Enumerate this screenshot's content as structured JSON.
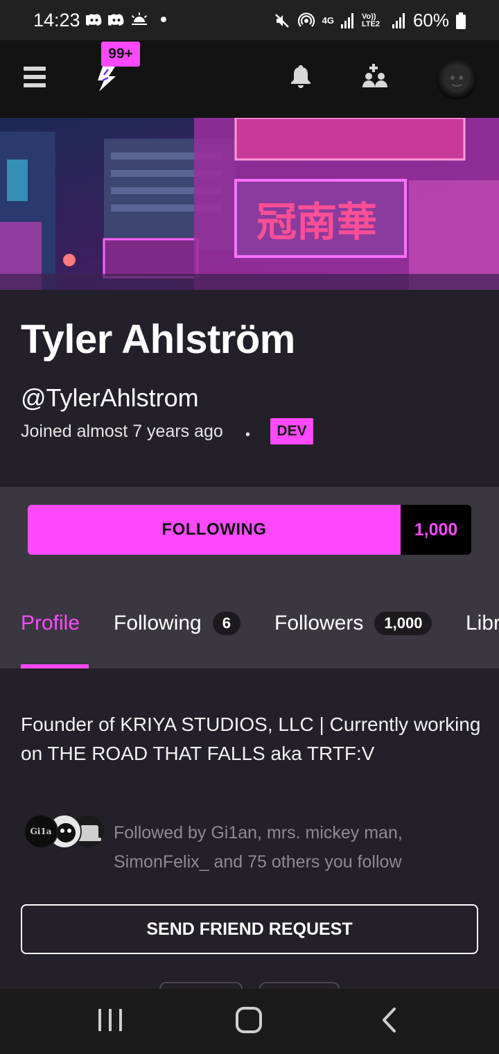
{
  "status_bar": {
    "time": "14:23",
    "network": "4G",
    "volte": "Vo)) LTE2",
    "battery": "60%"
  },
  "top_nav": {
    "notification_badge": "99+"
  },
  "profile": {
    "name": "Tyler Ahlström",
    "handle": "@TylerAhlstrom",
    "joined": "Joined almost 7 years ago",
    "badge": "DEV"
  },
  "follow": {
    "button_label": "FOLLOWING",
    "count": "1,000"
  },
  "tabs": [
    {
      "label": "Profile",
      "active": true
    },
    {
      "label": "Following",
      "count": "6"
    },
    {
      "label": "Followers",
      "count": "1,000"
    },
    {
      "label": "Libr"
    }
  ],
  "bio": "Founder of KRIYA STUDIOS, LLC | Currently working on THE ROAD THAT FALLS aka TRTF:V",
  "followed_by": {
    "text": "Followed by Gi1an, mrs. mickey man, SimonFelix_ and 75 others you follow",
    "avatar_1_text": "Gi1a"
  },
  "actions": {
    "friend_request": "SEND FRIEND REQUEST"
  },
  "colors": {
    "accent": "#ff49ff",
    "background": "#232029",
    "panel": "#3a3740",
    "nav": "#131313"
  },
  "icons": {
    "menu": "hamburger-menu-icon",
    "logo": "lightning-bolt-logo-icon",
    "notifications": "bell-icon",
    "friends": "add-friend-icon",
    "recents": "recent-apps-icon",
    "home": "home-icon",
    "back": "back-icon"
  }
}
